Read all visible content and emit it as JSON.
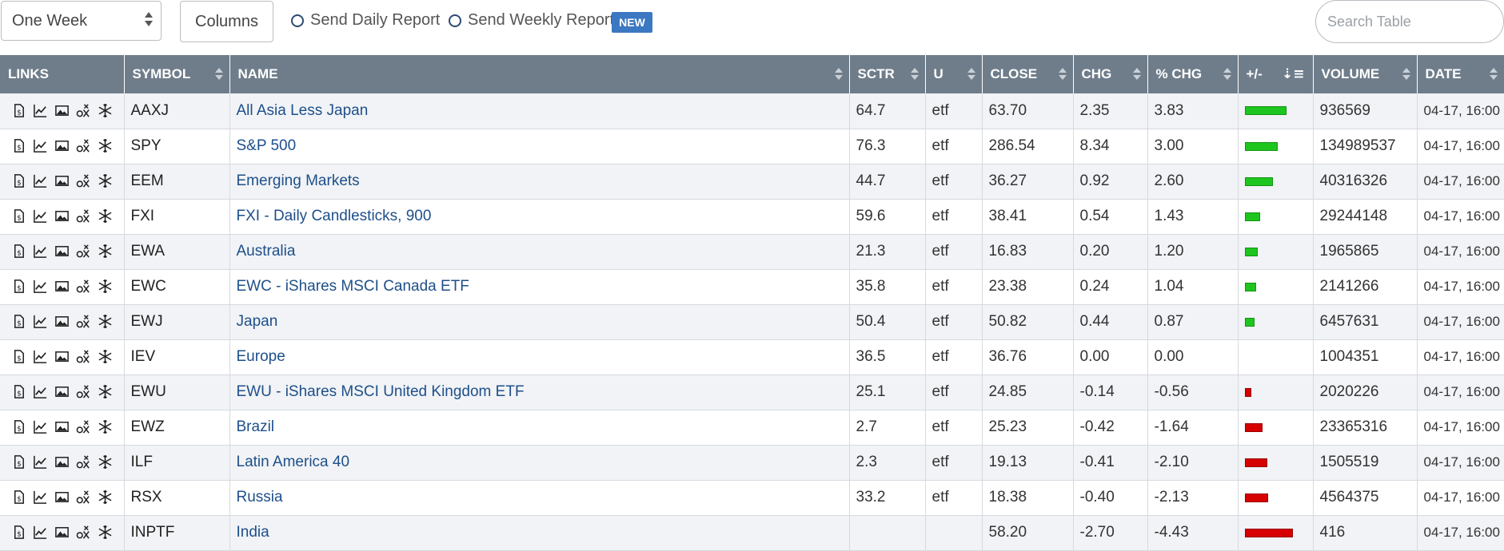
{
  "toolbar": {
    "period_value": "One Week",
    "columns_label": "Columns",
    "send_daily_label": "Send Daily Report",
    "send_weekly_label": "Send Weekly Report",
    "new_badge": "NEW",
    "search_placeholder": "Search Table"
  },
  "colors": {
    "header_bg": "#6f7d8b",
    "link": "#1e4f8a",
    "positive": "#1ec51e",
    "negative": "#d60000",
    "badge": "#3c78c2"
  },
  "icons": [
    "sharpchart-icon",
    "line-chart-icon",
    "image-chart-icon",
    "point-figure-icon",
    "seasonality-icon"
  ],
  "table": {
    "columns": [
      "LINKS",
      "SYMBOL",
      "NAME",
      "SCTR",
      "U",
      "CLOSE",
      "CHG",
      "% CHG",
      "+/-",
      "VOLUME",
      "DATE"
    ],
    "sorted_column": "+/-",
    "rows": [
      {
        "symbol": "AAXJ",
        "name": "All Asia Less Japan",
        "sctr": "64.7",
        "u": "etf",
        "close": "63.70",
        "chg": "2.35",
        "pct": "3.83",
        "bar": 3.83,
        "volume": "936569",
        "date": "04-17, 16:00"
      },
      {
        "symbol": "SPY",
        "name": "S&P 500",
        "sctr": "76.3",
        "u": "etf",
        "close": "286.54",
        "chg": "8.34",
        "pct": "3.00",
        "bar": 3.0,
        "volume": "134989537",
        "date": "04-17, 16:00"
      },
      {
        "symbol": "EEM",
        "name": "Emerging Markets",
        "sctr": "44.7",
        "u": "etf",
        "close": "36.27",
        "chg": "0.92",
        "pct": "2.60",
        "bar": 2.6,
        "volume": "40316326",
        "date": "04-17, 16:00"
      },
      {
        "symbol": "FXI",
        "name": "FXI - Daily Candlesticks, 900",
        "sctr": "59.6",
        "u": "etf",
        "close": "38.41",
        "chg": "0.54",
        "pct": "1.43",
        "bar": 1.43,
        "volume": "29244148",
        "date": "04-17, 16:00"
      },
      {
        "symbol": "EWA",
        "name": "Australia",
        "sctr": "21.3",
        "u": "etf",
        "close": "16.83",
        "chg": "0.20",
        "pct": "1.20",
        "bar": 1.2,
        "volume": "1965865",
        "date": "04-17, 16:00"
      },
      {
        "symbol": "EWC",
        "name": "EWC - iShares MSCI Canada ETF",
        "sctr": "35.8",
        "u": "etf",
        "close": "23.38",
        "chg": "0.24",
        "pct": "1.04",
        "bar": 1.04,
        "volume": "2141266",
        "date": "04-17, 16:00"
      },
      {
        "symbol": "EWJ",
        "name": "Japan",
        "sctr": "50.4",
        "u": "etf",
        "close": "50.82",
        "chg": "0.44",
        "pct": "0.87",
        "bar": 0.87,
        "volume": "6457631",
        "date": "04-17, 16:00"
      },
      {
        "symbol": "IEV",
        "name": "Europe",
        "sctr": "36.5",
        "u": "etf",
        "close": "36.76",
        "chg": "0.00",
        "pct": "0.00",
        "bar": 0.0,
        "volume": "1004351",
        "date": "04-17, 16:00"
      },
      {
        "symbol": "EWU",
        "name": "EWU - iShares MSCI United Kingdom ETF",
        "sctr": "25.1",
        "u": "etf",
        "close": "24.85",
        "chg": "-0.14",
        "pct": "-0.56",
        "bar": -0.56,
        "volume": "2020226",
        "date": "04-17, 16:00"
      },
      {
        "symbol": "EWZ",
        "name": "Brazil",
        "sctr": "2.7",
        "u": "etf",
        "close": "25.23",
        "chg": "-0.42",
        "pct": "-1.64",
        "bar": -1.64,
        "volume": "23365316",
        "date": "04-17, 16:00"
      },
      {
        "symbol": "ILF",
        "name": "Latin America 40",
        "sctr": "2.3",
        "u": "etf",
        "close": "19.13",
        "chg": "-0.41",
        "pct": "-2.10",
        "bar": -2.1,
        "volume": "1505519",
        "date": "04-17, 16:00"
      },
      {
        "symbol": "RSX",
        "name": "Russia",
        "sctr": "33.2",
        "u": "etf",
        "close": "18.38",
        "chg": "-0.40",
        "pct": "-2.13",
        "bar": -2.13,
        "volume": "4564375",
        "date": "04-17, 16:00"
      },
      {
        "symbol": "INPTF",
        "name": "India",
        "sctr": "",
        "u": "",
        "close": "58.20",
        "chg": "-2.70",
        "pct": "-4.43",
        "bar": -4.43,
        "volume": "416",
        "date": "04-17, 16:00"
      }
    ]
  }
}
